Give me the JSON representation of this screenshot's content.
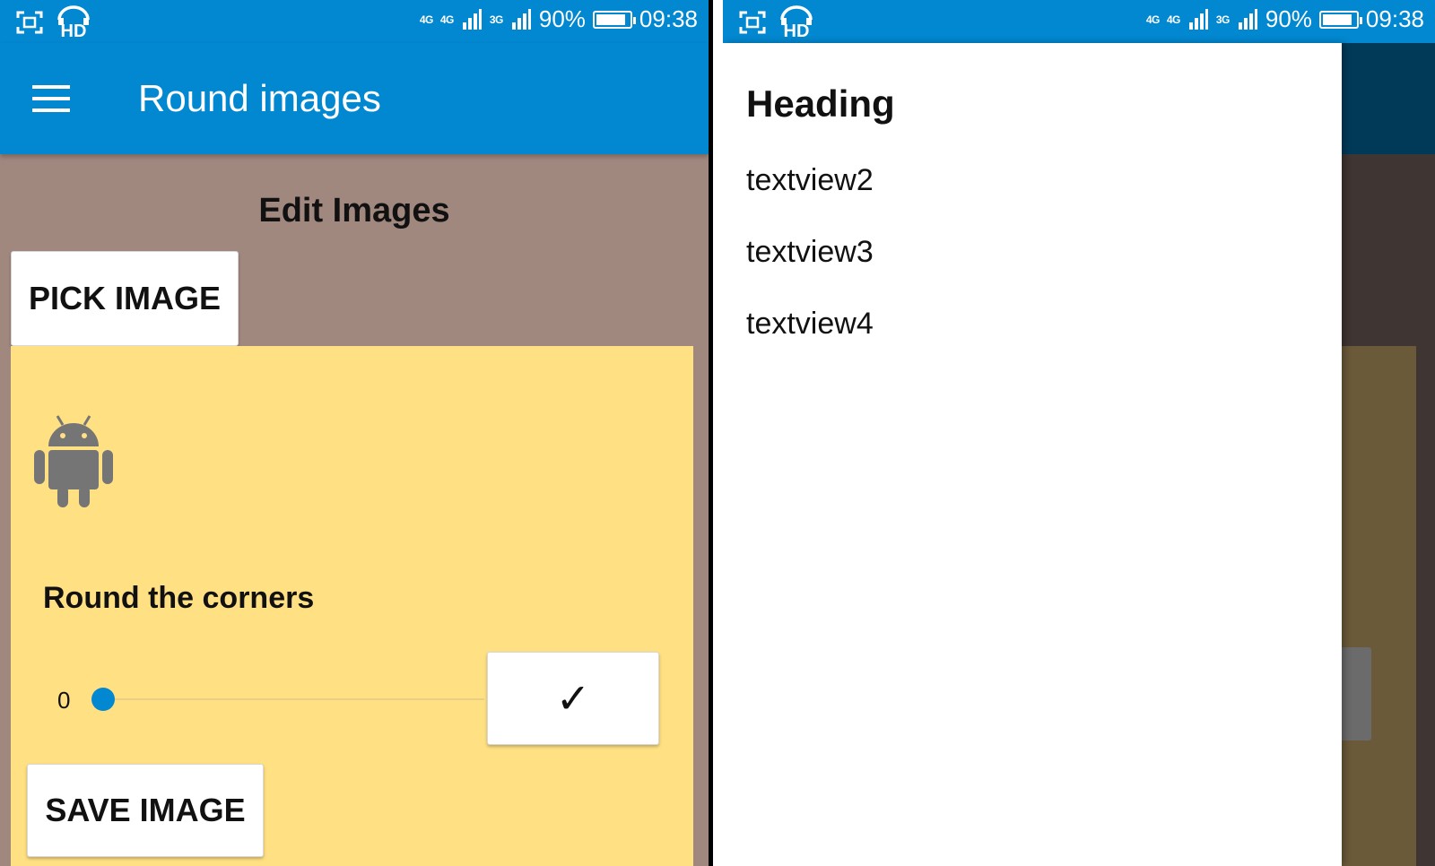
{
  "status_bar": {
    "left_icons": [
      "screenshot-icon",
      "hd-voice-icon"
    ],
    "signal_labels": [
      "4G",
      "4G",
      "3G"
    ],
    "battery": "90%",
    "battery_level": 0.9,
    "time": "09:38"
  },
  "left_screen": {
    "toolbar": {
      "menu_icon": "hamburger-menu-icon",
      "title": "Round images"
    },
    "section_title": "Edit Images",
    "pick_image_label": "PICK IMAGE",
    "image_placeholder_icon": "android-icon",
    "corners_label": "Round the corners",
    "slider": {
      "value": "0",
      "level": 0
    },
    "check_button_label": "✓",
    "save_image_label": "SAVE IMAGE"
  },
  "right_screen": {
    "drawer": {
      "heading": "Heading",
      "items": [
        {
          "label": "textview2"
        },
        {
          "label": "textview3"
        },
        {
          "label": "textview4"
        }
      ]
    }
  },
  "colors": {
    "primary": "#0288d1",
    "background": "#a1887f",
    "card": "#ffe082",
    "drawer": "#ffffff"
  }
}
